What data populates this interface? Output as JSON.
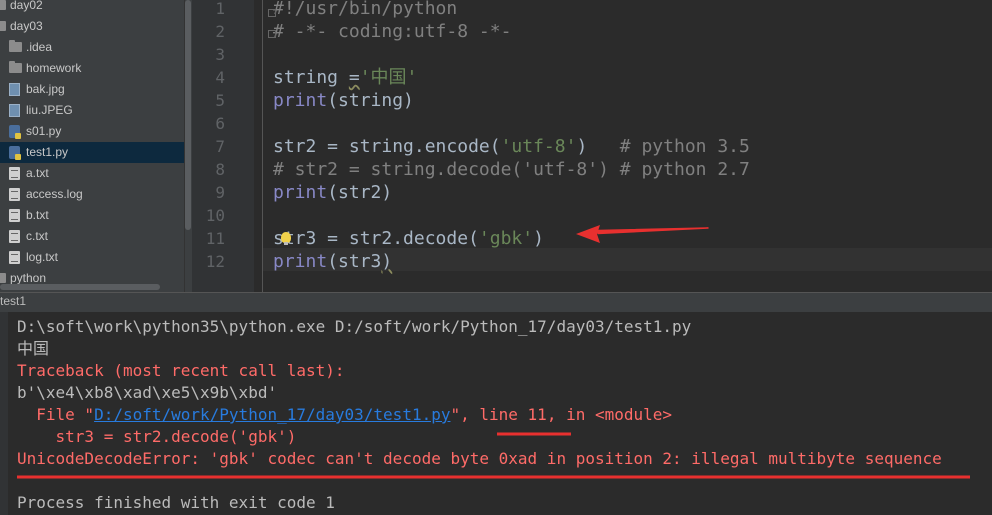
{
  "sidebar": {
    "items": [
      {
        "label": "day02",
        "icon": "folder-icon",
        "depth": 0
      },
      {
        "label": "day03",
        "icon": "folder-icon",
        "depth": 0
      },
      {
        "label": ".idea",
        "icon": "folder-icon",
        "depth": 1
      },
      {
        "label": "homework",
        "icon": "folder-icon",
        "depth": 1
      },
      {
        "label": "bak.jpg",
        "icon": "image-file-icon",
        "depth": 1
      },
      {
        "label": "liu.JPEG",
        "icon": "image-file-icon",
        "depth": 1
      },
      {
        "label": "s01.py",
        "icon": "python-file-icon",
        "depth": 1
      },
      {
        "label": "test1.py",
        "icon": "python-file-icon",
        "depth": 1,
        "selected": true
      },
      {
        "label": "a.txt",
        "icon": "text-file-icon",
        "depth": 1
      },
      {
        "label": "access.log",
        "icon": "text-file-icon",
        "depth": 1
      },
      {
        "label": "b.txt",
        "icon": "text-file-icon",
        "depth": 1
      },
      {
        "label": "c.txt",
        "icon": "text-file-icon",
        "depth": 1
      },
      {
        "label": "log.txt",
        "icon": "text-file-icon",
        "depth": 1
      },
      {
        "label": "python",
        "icon": "folder-icon",
        "depth": 0
      }
    ]
  },
  "editor": {
    "lines": [
      {
        "no": "1",
        "parts": [
          {
            "t": "#!/usr/bin/python",
            "c": "comment"
          }
        ]
      },
      {
        "no": "2",
        "parts": [
          {
            "t": "# -*- coding:utf-8 -*-",
            "c": "comment"
          }
        ]
      },
      {
        "no": "3",
        "parts": []
      },
      {
        "no": "4",
        "parts": [
          {
            "t": "string ",
            "c": ""
          },
          {
            "t": "=",
            "c": "wavy"
          },
          {
            "t": "'中国'",
            "c": "str"
          }
        ]
      },
      {
        "no": "5",
        "parts": [
          {
            "t": "print",
            "c": "kw"
          },
          {
            "t": "(string)",
            "c": ""
          }
        ]
      },
      {
        "no": "6",
        "parts": []
      },
      {
        "no": "7",
        "parts": [
          {
            "t": "str2 = string.encode(",
            "c": ""
          },
          {
            "t": "'utf-8'",
            "c": "str"
          },
          {
            "t": ")   ",
            "c": ""
          },
          {
            "t": "# python 3.5",
            "c": "comment"
          }
        ]
      },
      {
        "no": "8",
        "parts": [
          {
            "t": "# str2 = string.decode('utf-8') # python 2.7",
            "c": "comment"
          }
        ]
      },
      {
        "no": "9",
        "parts": [
          {
            "t": "print",
            "c": "kw"
          },
          {
            "t": "(str2)",
            "c": ""
          }
        ]
      },
      {
        "no": "10",
        "parts": []
      },
      {
        "no": "11",
        "parts": [
          {
            "t": "str3 = str2.decode(",
            "c": ""
          },
          {
            "t": "'gbk'",
            "c": "str"
          },
          {
            "t": ")",
            "c": ""
          }
        ]
      },
      {
        "no": "12",
        "parts": [
          {
            "t": "print",
            "c": "kw"
          },
          {
            "t": "(str3",
            "c": ""
          },
          {
            "t": ")",
            "c": "wavy"
          }
        ]
      }
    ]
  },
  "run_panel": {
    "tab_label": "test1"
  },
  "console": {
    "lines": [
      {
        "parts": [
          {
            "t": "D:\\soft\\work\\python35\\python.exe D:/soft/work/Python_17/day03/test1.py",
            "c": ""
          }
        ]
      },
      {
        "parts": [
          {
            "t": "中国",
            "c": ""
          }
        ]
      },
      {
        "parts": [
          {
            "t": "Traceback (most recent call last):",
            "c": "err"
          }
        ]
      },
      {
        "parts": [
          {
            "t": "b'\\xe4\\xb8\\xad\\xe5\\x9b\\xbd'",
            "c": ""
          }
        ]
      },
      {
        "parts": [
          {
            "t": "  File \"",
            "c": "err"
          },
          {
            "t": "D:/soft/work/Python_17/day03/test1.py",
            "c": "link"
          },
          {
            "t": "\", line 11, in <module>",
            "c": "err"
          }
        ]
      },
      {
        "parts": [
          {
            "t": "    str3 = str2.decode('gbk')",
            "c": "err"
          }
        ]
      },
      {
        "parts": [
          {
            "t": "UnicodeDecodeError: 'gbk' codec can't decode byte 0xad in position 2: illegal multibyte sequence",
            "c": "err"
          }
        ]
      },
      {
        "parts": []
      },
      {
        "parts": [
          {
            "t": "Process finished with exit code 1",
            "c": ""
          }
        ]
      }
    ]
  },
  "colors": {
    "annotation_red": "#E8302F",
    "error_text": "#FF6B68",
    "string": "#6A8759",
    "comment": "#808080",
    "keyword": "#8888C6"
  }
}
